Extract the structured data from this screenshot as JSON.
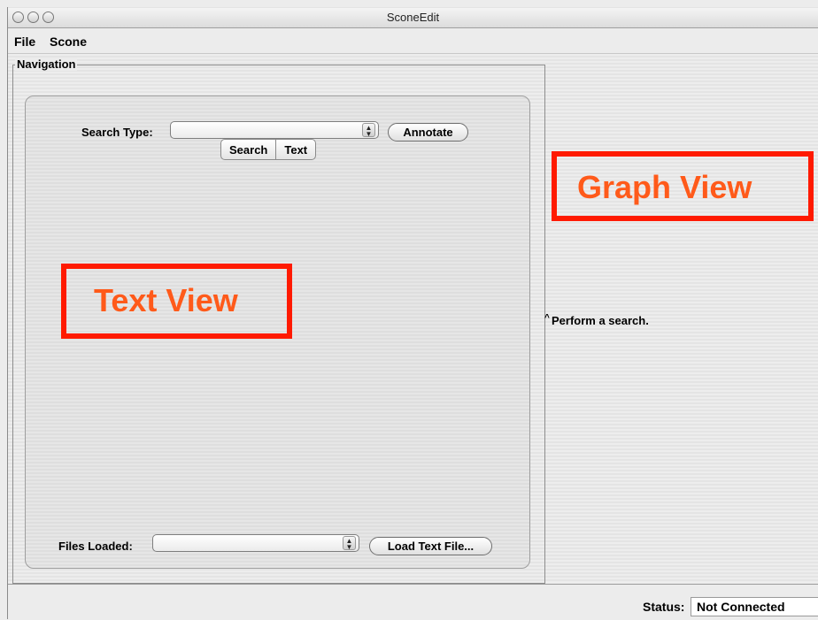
{
  "window": {
    "title": "SconeEdit"
  },
  "menu": {
    "items": [
      "File",
      "Scone"
    ]
  },
  "navigation": {
    "legend": "Navigation",
    "tabs": [
      "Search",
      "Text"
    ],
    "search_type_label": "Search Type:",
    "search_type_value": "",
    "annotate_label": "Annotate",
    "files_loaded_label": "Files Loaded:",
    "files_loaded_value": "",
    "load_text_file_label": "Load Text File..."
  },
  "annotations": {
    "text_view": "Text View",
    "graph_view": "Graph View"
  },
  "graph": {
    "hint": "Perform a search.",
    "hint_prefix": "^"
  },
  "status": {
    "label": "Status:",
    "value": "Not Connected"
  },
  "colors": {
    "annotation_border": "#ff1a00",
    "annotation_text": "#ff5a1a"
  }
}
